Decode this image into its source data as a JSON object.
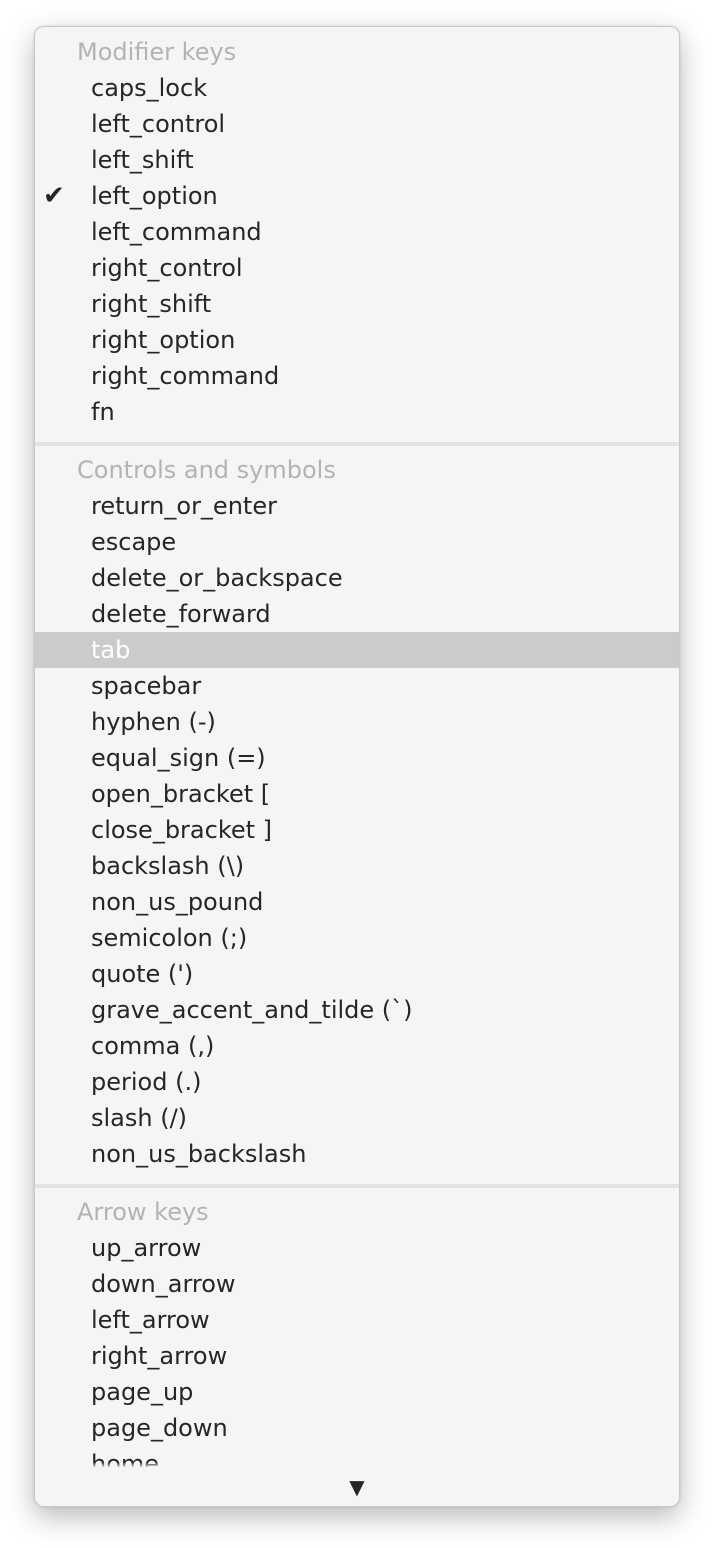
{
  "menu": {
    "sections": [
      {
        "header": "Modifier keys",
        "items": [
          {
            "label": "caps_lock",
            "checked": false,
            "highlighted": false
          },
          {
            "label": "left_control",
            "checked": false,
            "highlighted": false
          },
          {
            "label": "left_shift",
            "checked": false,
            "highlighted": false
          },
          {
            "label": "left_option",
            "checked": true,
            "highlighted": false
          },
          {
            "label": "left_command",
            "checked": false,
            "highlighted": false
          },
          {
            "label": "right_control",
            "checked": false,
            "highlighted": false
          },
          {
            "label": "right_shift",
            "checked": false,
            "highlighted": false
          },
          {
            "label": "right_option",
            "checked": false,
            "highlighted": false
          },
          {
            "label": "right_command",
            "checked": false,
            "highlighted": false
          },
          {
            "label": "fn",
            "checked": false,
            "highlighted": false
          }
        ]
      },
      {
        "header": "Controls and symbols",
        "items": [
          {
            "label": "return_or_enter",
            "checked": false,
            "highlighted": false
          },
          {
            "label": "escape",
            "checked": false,
            "highlighted": false
          },
          {
            "label": "delete_or_backspace",
            "checked": false,
            "highlighted": false
          },
          {
            "label": "delete_forward",
            "checked": false,
            "highlighted": false
          },
          {
            "label": "tab",
            "checked": false,
            "highlighted": true
          },
          {
            "label": "spacebar",
            "checked": false,
            "highlighted": false
          },
          {
            "label": "hyphen (-)",
            "checked": false,
            "highlighted": false
          },
          {
            "label": "equal_sign (=)",
            "checked": false,
            "highlighted": false
          },
          {
            "label": "open_bracket [",
            "checked": false,
            "highlighted": false
          },
          {
            "label": "close_bracket ]",
            "checked": false,
            "highlighted": false
          },
          {
            "label": "backslash (\\)",
            "checked": false,
            "highlighted": false
          },
          {
            "label": "non_us_pound",
            "checked": false,
            "highlighted": false
          },
          {
            "label": "semicolon (;)",
            "checked": false,
            "highlighted": false
          },
          {
            "label": "quote (')",
            "checked": false,
            "highlighted": false
          },
          {
            "label": "grave_accent_and_tilde (`)",
            "checked": false,
            "highlighted": false
          },
          {
            "label": "comma (,)",
            "checked": false,
            "highlighted": false
          },
          {
            "label": "period (.)",
            "checked": false,
            "highlighted": false
          },
          {
            "label": "slash (/)",
            "checked": false,
            "highlighted": false
          },
          {
            "label": "non_us_backslash",
            "checked": false,
            "highlighted": false
          }
        ]
      },
      {
        "header": "Arrow keys",
        "items": [
          {
            "label": "up_arrow",
            "checked": false,
            "highlighted": false
          },
          {
            "label": "down_arrow",
            "checked": false,
            "highlighted": false
          },
          {
            "label": "left_arrow",
            "checked": false,
            "highlighted": false
          },
          {
            "label": "right_arrow",
            "checked": false,
            "highlighted": false
          },
          {
            "label": "page_up",
            "checked": false,
            "highlighted": false
          },
          {
            "label": "page_down",
            "checked": false,
            "highlighted": false
          },
          {
            "label": "home",
            "checked": false,
            "highlighted": false
          }
        ]
      }
    ],
    "check_glyph": "✔",
    "check_icon": "checkmark-icon",
    "scroll_down_glyph": "▼",
    "scroll_down_icon": "scroll-down-arrow-icon",
    "colors": {
      "background": "#f5f5f5",
      "header_text": "#b3b3b3",
      "item_text": "#262626",
      "highlight_bg": "#cbcbcb",
      "highlight_text": "#ffffff",
      "separator": "#e3e3e3"
    }
  }
}
